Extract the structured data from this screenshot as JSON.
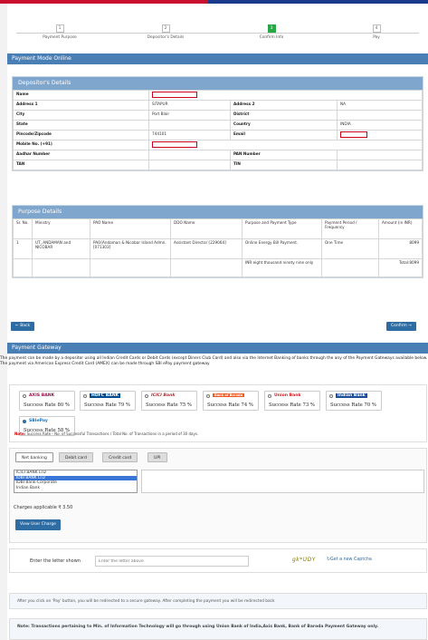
{
  "steps": [
    {
      "num": "1",
      "label": "Payment Purpose"
    },
    {
      "num": "2",
      "label": "Depositor's Details"
    },
    {
      "num": "3",
      "label": "Confirm Info"
    },
    {
      "num": "4",
      "label": "Pay"
    }
  ],
  "panel_title": "Payment Mode Online",
  "depositor": {
    "heading": "Depositor's Details",
    "name_label": "Name",
    "address1_label": "Address 1",
    "address1": "SITAPUR",
    "address2_label": "Address 2",
    "address2": "NA",
    "city_label": "City",
    "city": "Port Blair",
    "district_label": "District",
    "district": "",
    "state_label": "State",
    "state": "",
    "country_label": "Country",
    "country": "INDIA",
    "pincode_label": "Pincode/Zipcode",
    "pincode": "744101",
    "email_label": "Email",
    "mobile_label": "Mobile No. (+91)",
    "aadhar_label": "Aadhar Number",
    "aadhar": "",
    "pan_label": "PAN Number",
    "pan": "",
    "tan_label": "TAN",
    "tan": "",
    "tin_label": "TIN",
    "tin": ""
  },
  "purpose": {
    "heading": "Purpose Details",
    "headers": [
      "Sr. No.",
      "Ministry",
      "PAO Name",
      "DDO Name",
      "Purpose and Payment Type",
      "Payment Period / Frequency",
      "Amount (in INR)"
    ],
    "row": [
      "1",
      "UT, ANDAMAN and NICOBAR",
      "PAO(Andaman & Nicobar Island Admn. [071303]",
      "Assistant Director [229064]",
      "Online Energy Bill Payment.",
      "One Time",
      "8099"
    ],
    "words": "INR eight thousand ninety nine only",
    "total": "Total:8099"
  },
  "back_label": "← Back",
  "confirm_label": "Confirm →",
  "gateway_title": "Payment Gateway",
  "gateway_text": "The payment can be made by a depositor using all Indian Credit Cards or Debit Cards (except Diners Club Card) and also via the Internet Banking of banks through the any of the Payment Gateways available below. The payment via American Express Credit Card (AMEX) can be made through SBI ePay payment gateway",
  "gateways": [
    {
      "logo": "AXIS BANK",
      "rate": "Success Rate 80 %",
      "color": "#97144d"
    },
    {
      "logo": "HDFC BANK",
      "rate": "Success Rate 79 %",
      "color": "#004c8f"
    },
    {
      "logo": "ICICI Bank",
      "rate": "Success Rate 75 %",
      "color": "#b02a30"
    },
    {
      "logo": "Bank of Baroda",
      "rate": "Success Rate 74 %",
      "color": "#f15a22"
    },
    {
      "logo": "Union Bank",
      "rate": "Success Rate 73 %",
      "color": "#d71920"
    },
    {
      "logo": "Indian Bank",
      "rate": "Success Rate 70 %",
      "color": "#1b4e9b"
    },
    {
      "logo": "SBIePay",
      "rate": "Success Rate 58 %",
      "color": "#1b75bc"
    }
  ],
  "rate_note_bold": "Note:",
  "rate_note": " Success Rate - No. of Successful Transactions / Total No. of Transactions in a period of 30 days.",
  "tabs": [
    "Net banking",
    "Debit card",
    "Credit card",
    "UPI"
  ],
  "banks": [
    "ICICI BANK LTD",
    "IDBI BANK LTD",
    "IDBI Bank-Corporate",
    "Indian Bank"
  ],
  "charges": "Charges applicable ₹ 3.50",
  "view_charge": "View User Charge",
  "captcha": {
    "label": "Enter the letter shown",
    "placeholder": "Enter the letter above",
    "code": "gk*UDY",
    "new_link": "Get a new Captcha"
  },
  "redirect_note": "After you click on 'Pay' button, you will be redirected to a secure gateway. After completing the payment you will be redirected back",
  "mit_note": "Note: Transactions pertaining to Min. of Information Technology will go through using Union Bank of India,Axis Bank, Bank of Baroda Payment Gateway only."
}
